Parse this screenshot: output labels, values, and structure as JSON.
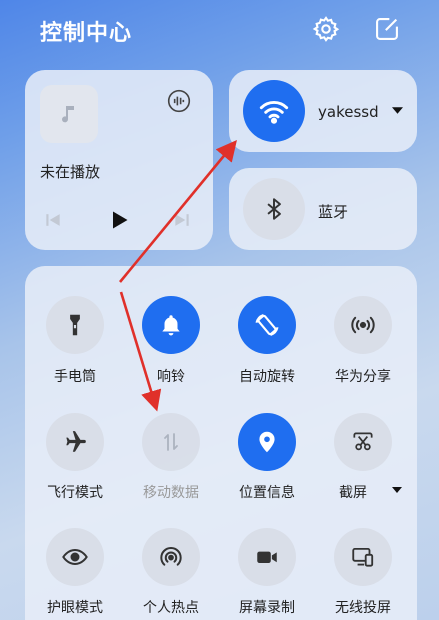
{
  "header": {
    "title": "控制中心",
    "settings_icon": "gear-icon",
    "edit_icon": "edit-icon"
  },
  "media": {
    "status": "未在播放",
    "icons": [
      "music-note-icon",
      "audio-output-icon",
      "previous-icon",
      "play-icon",
      "next-icon"
    ]
  },
  "wifi": {
    "network": "yakessd",
    "icon": "wifi-icon",
    "state": "on"
  },
  "bluetooth": {
    "label": "蓝牙",
    "icon": "bluetooth-icon",
    "state": "off"
  },
  "toggles": [
    {
      "label": "手电筒",
      "icon": "flashlight-icon",
      "state": "off"
    },
    {
      "label": "响铃",
      "icon": "bell-icon",
      "state": "on"
    },
    {
      "label": "自动旋转",
      "icon": "rotate-icon",
      "state": "on"
    },
    {
      "label": "华为分享",
      "icon": "share-icon",
      "state": "off"
    },
    {
      "label": "飞行模式",
      "icon": "airplane-icon",
      "state": "off"
    },
    {
      "label": "移动数据",
      "icon": "mobile-data-icon",
      "state": "disabled"
    },
    {
      "label": "位置信息",
      "icon": "location-icon",
      "state": "on"
    },
    {
      "label": "截屏",
      "icon": "screenshot-icon",
      "state": "off"
    },
    {
      "label": "护眼模式",
      "icon": "eye-icon",
      "state": "off"
    },
    {
      "label": "个人热点",
      "icon": "hotspot-icon",
      "state": "off"
    },
    {
      "label": "屏幕录制",
      "icon": "video-record-icon",
      "state": "off"
    },
    {
      "label": "无线投屏",
      "icon": "cast-screen-icon",
      "state": "off"
    }
  ],
  "colors": {
    "accent": "#1f6ef0",
    "annotation_arrow": "#e0302a",
    "tile_off": "#d9dee8"
  }
}
